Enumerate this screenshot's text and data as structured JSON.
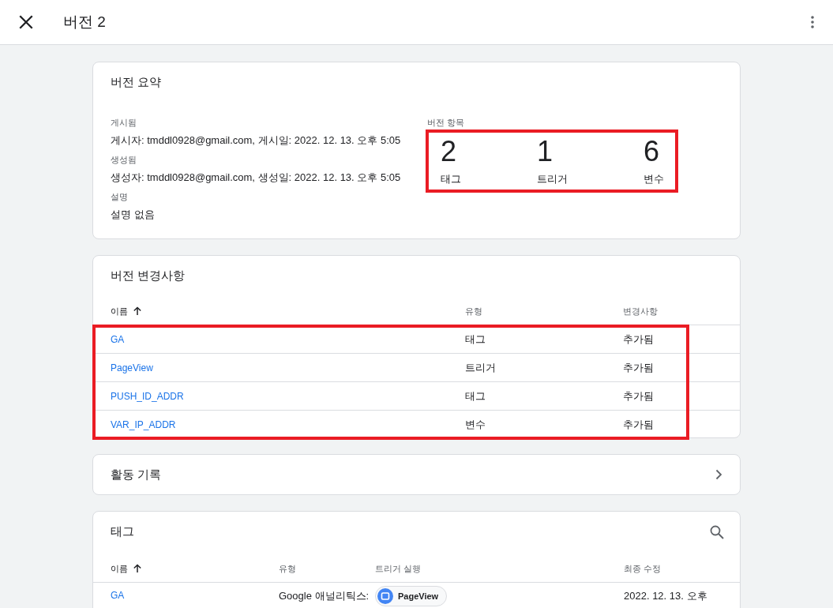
{
  "header": {
    "title": "버전 2"
  },
  "summary": {
    "title": "버전 요약",
    "fields": [
      {
        "label": "게시됨",
        "value": "게시자: tmddl0928@gmail.com, 게시일: 2022. 12. 13. 오후 5:05"
      },
      {
        "label": "생성됨",
        "value": "생성자: tmddl0928@gmail.com, 생성일: 2022. 12. 13. 오후 5:05"
      },
      {
        "label": "설명",
        "value": "설명 없음"
      }
    ],
    "counts": {
      "label": "버전 항목",
      "highlighted": true,
      "items": [
        {
          "number": "2",
          "label": "태그"
        },
        {
          "number": "1",
          "label": "트리거"
        },
        {
          "number": "6",
          "label": "변수"
        }
      ]
    }
  },
  "changes": {
    "title": "버전 변경사항",
    "highlighted": true,
    "columns": [
      {
        "label": "이름",
        "sorted": true
      },
      {
        "label": "유형",
        "sorted": false
      },
      {
        "label": "변경사항",
        "sorted": false
      }
    ],
    "rows": [
      {
        "name": "GA",
        "type": "태그",
        "change": "추가됨"
      },
      {
        "name": "PageView",
        "type": "트리거",
        "change": "추가됨"
      },
      {
        "name": "PUSH_ID_ADDR",
        "type": "태그",
        "change": "추가됨"
      },
      {
        "name": "VAR_IP_ADDR",
        "type": "변수",
        "change": "추가됨"
      }
    ]
  },
  "activity": {
    "title": "활동 기록"
  },
  "tags": {
    "title": "태그",
    "columns": [
      {
        "label": "이름",
        "sorted": true
      },
      {
        "label": "유형",
        "sorted": false
      },
      {
        "label": "트리거 실행",
        "sorted": false
      },
      {
        "label": "최종 수정",
        "sorted": false
      }
    ],
    "rows": [
      {
        "name": "GA",
        "type": "Google 애널리틱스:",
        "trigger": "PageView",
        "modified": "2022. 12. 13. 오후"
      }
    ]
  }
}
